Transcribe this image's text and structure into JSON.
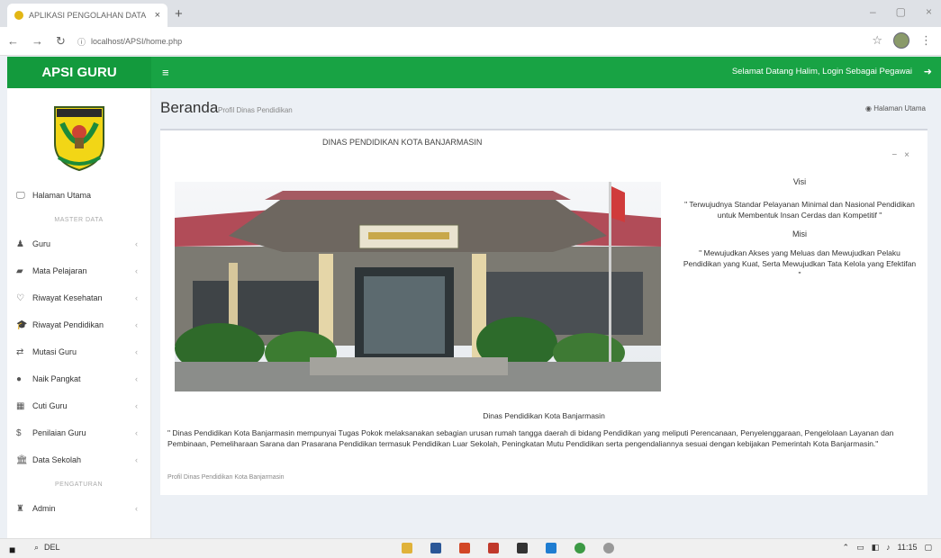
{
  "browser": {
    "tab_title": "APLIKASI PENGOLAHAN DATA",
    "url": "localhost/APSI/home.php"
  },
  "header": {
    "brand": "APSI GURU",
    "welcome": "Selamat Datang Halim, Login Sebagai Pegawai"
  },
  "sidebar": {
    "items": [
      {
        "label": "Halaman Utama",
        "icon": "monitor-icon"
      },
      {
        "header": "MASTER DATA"
      },
      {
        "label": "Guru",
        "icon": "users-icon"
      },
      {
        "label": "Mata Pelajaran",
        "icon": "book-icon"
      },
      {
        "label": "Riwayat Kesehatan",
        "icon": "heart-icon"
      },
      {
        "label": "Riwayat Pendidikan",
        "icon": "graduation-cap-icon"
      },
      {
        "label": "Mutasi Guru",
        "icon": "exchange-icon"
      },
      {
        "label": "Naik Pangkat",
        "icon": "circle-icon"
      },
      {
        "label": "Cuti Guru",
        "icon": "calendar-icon"
      },
      {
        "label": "Penilaian Guru",
        "icon": "dollar-icon"
      },
      {
        "label": "Data Sekolah",
        "icon": "bank-icon"
      },
      {
        "header": "PENGATURAN"
      },
      {
        "label": "Admin",
        "icon": "user-secret-icon"
      }
    ]
  },
  "content": {
    "title": "Beranda",
    "subtitle": "Profil Dinas Pendidikan",
    "breadcrumb": "Halaman Utama",
    "box_title": "DINAS PENDIDIKAN KOTA BANJARMASIN",
    "visi_title": "Visi",
    "visi_text": "\" Terwujudnya Standar Pelayanan Minimal dan Nasional Pendidikan untuk Membentuk Insan Cerdas dan Kompetitif \"",
    "misi_title": "Misi",
    "misi_text": "\" Mewujudkan Akses yang Meluas dan Mewujudkan Pelaku Pendidikan yang Kuat, Serta Mewujudkan Tata Kelola yang Efektifan \"",
    "caption": "Dinas Pendidikan Kota Banjarmasin",
    "description": "\" Dinas Pendidikan Kota Banjarmasin mempunyai Tugas Pokok melaksanakan sebagian urusan rumah tangga daerah di bidang Pendidikan yang meliputi Perencanaan, Penyelenggaraan, Pengelolaan Layanan dan Pembinaan, Pemeliharaan Sarana dan Prasarana Pendidikan termasuk Pendidikan Luar Sekolah, Peningkatan Mutu Pendidikan serta pengendaliannya sesuai dengan kebijakan Pemerintah Kota Banjarmasin.\"",
    "footer_note": "Profil Dinas Pendidikan Kota Banjarmasin"
  },
  "taskbar": {
    "search": "DEL",
    "time": "11:15"
  },
  "colors": {
    "header_green": "#18a344",
    "brand_green": "#139a3d"
  }
}
